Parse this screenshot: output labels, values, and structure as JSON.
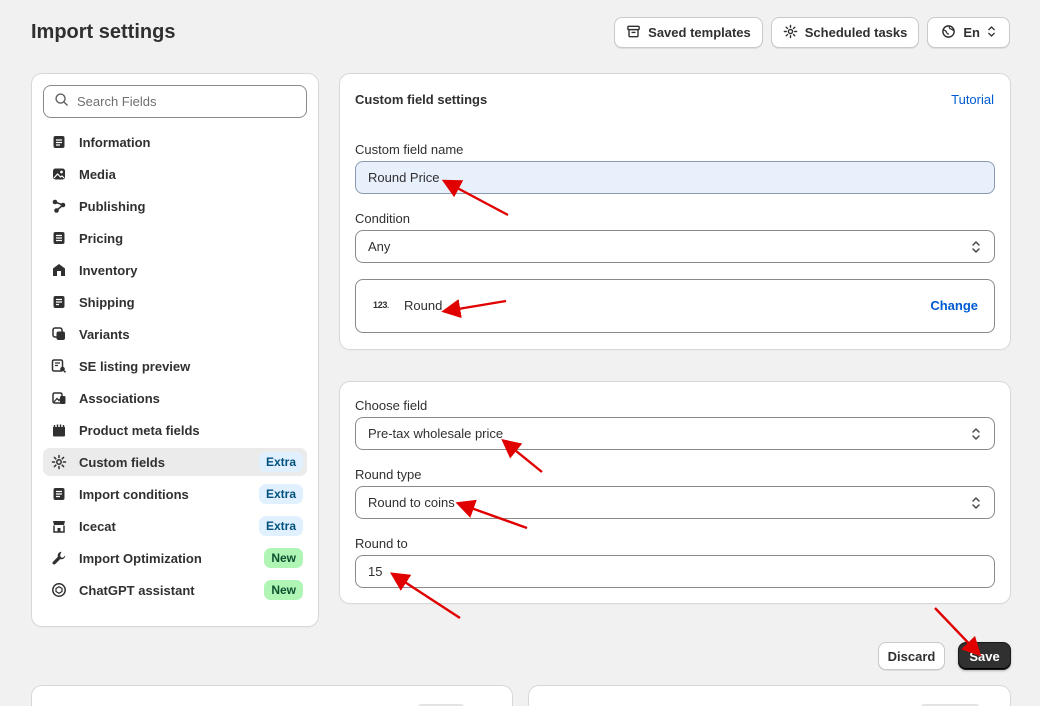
{
  "page": {
    "title": "Import settings"
  },
  "top_actions": {
    "saved_templates": "Saved templates",
    "scheduled_tasks": "Scheduled tasks",
    "language": "En"
  },
  "sidebar": {
    "search_placeholder": "Search Fields",
    "items": [
      {
        "label": "Information",
        "icon": "document-icon"
      },
      {
        "label": "Media",
        "icon": "image-icon"
      },
      {
        "label": "Publishing",
        "icon": "publish-icon"
      },
      {
        "label": "Pricing",
        "icon": "price-list-icon"
      },
      {
        "label": "Inventory",
        "icon": "warehouse-icon"
      },
      {
        "label": "Shipping",
        "icon": "package-icon"
      },
      {
        "label": "Variants",
        "icon": "variants-icon"
      },
      {
        "label": "SE listing preview",
        "icon": "search-preview-icon"
      },
      {
        "label": "Associations",
        "icon": "associations-icon"
      },
      {
        "label": "Product meta fields",
        "icon": "metafields-icon"
      },
      {
        "label": "Custom fields",
        "icon": "gear-icon",
        "badge": "Extra",
        "active": true
      },
      {
        "label": "Import conditions",
        "icon": "notes-icon",
        "badge": "Extra"
      },
      {
        "label": "Icecat",
        "icon": "store-icon",
        "badge": "Extra"
      },
      {
        "label": "Import Optimization",
        "icon": "wrench-icon",
        "badge": "New"
      },
      {
        "label": "ChatGPT assistant",
        "icon": "chatgpt-icon",
        "badge": "New"
      }
    ]
  },
  "custom_card": {
    "title": "Custom field settings",
    "tutorial": "Tutorial",
    "name_label": "Custom field name",
    "name_value": "Round Price",
    "condition_label": "Condition",
    "condition_value": "Any",
    "function_icon_text": "123",
    "function_name": "Round",
    "change": "Change"
  },
  "round_card": {
    "choose_label": "Choose field",
    "choose_value": "Pre-tax wholesale price",
    "type_label": "Round type",
    "type_value": "Round to coins",
    "to_label": "Round to",
    "to_value": "15"
  },
  "footer": {
    "discard": "Discard",
    "save": "Save"
  },
  "colors": {
    "accent_link": "#005bd3",
    "primary_button": "#303030",
    "annotation_arrow": "#e00000"
  }
}
